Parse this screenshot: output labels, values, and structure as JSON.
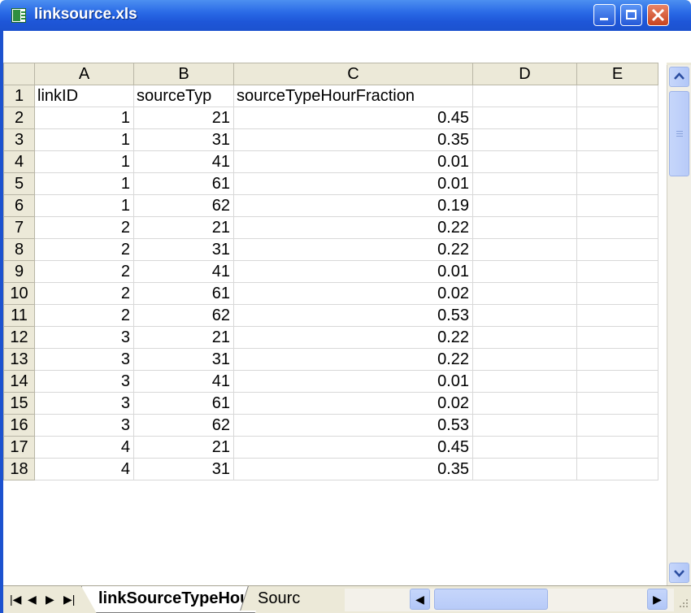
{
  "window": {
    "title": "linksource.xls"
  },
  "columns": [
    "A",
    "B",
    "C",
    "D",
    "E"
  ],
  "rows": [
    {
      "n": "1",
      "a": "linkID",
      "b": "sourceTyp",
      "c": "sourceTypeHourFraction"
    },
    {
      "n": "2",
      "a": "1",
      "b": "21",
      "c": "0.45"
    },
    {
      "n": "3",
      "a": "1",
      "b": "31",
      "c": "0.35"
    },
    {
      "n": "4",
      "a": "1",
      "b": "41",
      "c": "0.01"
    },
    {
      "n": "5",
      "a": "1",
      "b": "61",
      "c": "0.01"
    },
    {
      "n": "6",
      "a": "1",
      "b": "62",
      "c": "0.19"
    },
    {
      "n": "7",
      "a": "2",
      "b": "21",
      "c": "0.22"
    },
    {
      "n": "8",
      "a": "2",
      "b": "31",
      "c": "0.22"
    },
    {
      "n": "9",
      "a": "2",
      "b": "41",
      "c": "0.01"
    },
    {
      "n": "10",
      "a": "2",
      "b": "61",
      "c": "0.02"
    },
    {
      "n": "11",
      "a": "2",
      "b": "62",
      "c": "0.53"
    },
    {
      "n": "12",
      "a": "3",
      "b": "21",
      "c": "0.22"
    },
    {
      "n": "13",
      "a": "3",
      "b": "31",
      "c": "0.22"
    },
    {
      "n": "14",
      "a": "3",
      "b": "41",
      "c": "0.01"
    },
    {
      "n": "15",
      "a": "3",
      "b": "61",
      "c": "0.02"
    },
    {
      "n": "16",
      "a": "3",
      "b": "62",
      "c": "0.53"
    },
    {
      "n": "17",
      "a": "4",
      "b": "21",
      "c": "0.45"
    },
    {
      "n": "18",
      "a": "4",
      "b": "31",
      "c": "0.35"
    }
  ],
  "sheet_tabs": {
    "active": "linkSourceTypeHour",
    "second": "Sourc"
  },
  "colors": {
    "titlebar": "#1c52cf",
    "header_bg": "#ece9d8",
    "close_button": "#c8431f"
  },
  "icons": [
    "excel-file-icon",
    "minimize-icon",
    "maximize-icon",
    "close-icon",
    "scroll-up-icon",
    "scroll-down-icon",
    "scroll-left-icon",
    "scroll-right-icon",
    "first-sheet-icon",
    "prev-sheet-icon",
    "next-sheet-icon",
    "last-sheet-icon",
    "resize-grip-icon"
  ]
}
